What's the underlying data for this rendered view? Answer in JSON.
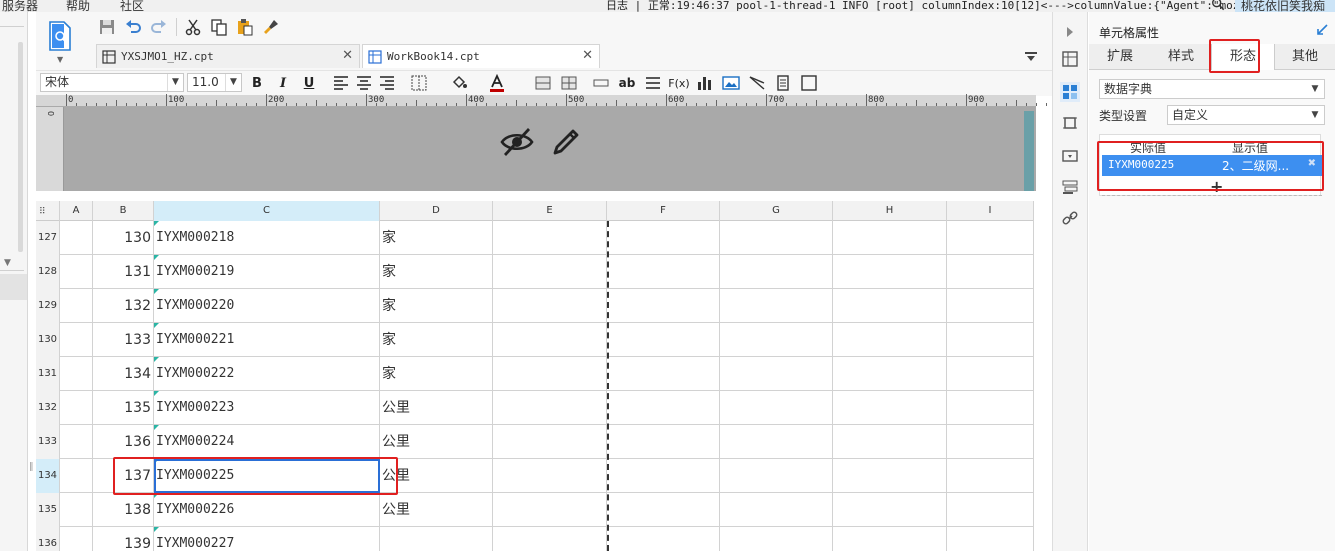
{
  "menu": {
    "items": [
      "服务器",
      "帮助",
      "社区"
    ],
    "log": "日志",
    "log_status": "正常:19:46:37 pool-1-thread-1 INFO [root] columnIndex:10[12]<--->columnValue:{\"Agent\":\"moz...",
    "user": "桃花依旧笑我痴"
  },
  "tabs": [
    {
      "label": "YXSJMO1_HZ.cpt",
      "active": false
    },
    {
      "label": "WorkBook14.cpt",
      "active": true
    }
  ],
  "format": {
    "font_name": "宋体",
    "font_size": "11.0",
    "bold": "B",
    "italic": "I",
    "underline": "U",
    "text_tool": "ab",
    "formula": "F(x)"
  },
  "ruler": {
    "labels": [
      "0",
      "100",
      "200",
      "300",
      "400",
      "500",
      "600",
      "700",
      "800",
      "900"
    ],
    "vertical": "0"
  },
  "grid": {
    "columns": [
      "A",
      "B",
      "C",
      "D",
      "E",
      "F",
      "G",
      "H",
      "I"
    ],
    "selected_column": "C",
    "selected_row": "134",
    "rows": [
      {
        "num": "127",
        "b": "130",
        "c": "IYXM000218",
        "d": "家"
      },
      {
        "num": "128",
        "b": "131",
        "c": "IYXM000219",
        "d": "家"
      },
      {
        "num": "129",
        "b": "132",
        "c": "IYXM000220",
        "d": "家"
      },
      {
        "num": "130",
        "b": "133",
        "c": "IYXM000221",
        "d": "家"
      },
      {
        "num": "131",
        "b": "134",
        "c": "IYXM000222",
        "d": "家"
      },
      {
        "num": "132",
        "b": "135",
        "c": "IYXM000223",
        "d": "公里"
      },
      {
        "num": "133",
        "b": "136",
        "c": "IYXM000224",
        "d": "公里"
      },
      {
        "num": "134",
        "b": "137",
        "c": "IYXM000225",
        "d": "公里"
      },
      {
        "num": "135",
        "b": "138",
        "c": "IYXM000226",
        "d": "公里"
      },
      {
        "num": "136",
        "b": "139",
        "c": "IYXM000227",
        "d": ""
      }
    ]
  },
  "panel": {
    "title": "单元格属性",
    "tabs": [
      "扩展",
      "样式",
      "形态",
      "其他"
    ],
    "active_tab": "形态",
    "widget_type": "数据字典",
    "type_label": "类型设置",
    "type_value": "自定义",
    "dict_headers": [
      "实际值",
      "显示值"
    ],
    "dict_rows": [
      {
        "actual": "IYXM000225",
        "display": "2、二级网..."
      }
    ],
    "add": "+"
  },
  "colors": {
    "accent": "#3d8ff0",
    "highlight": "#e02020",
    "selection": "#2a6fd6",
    "header_selected": "#d4edf9"
  }
}
